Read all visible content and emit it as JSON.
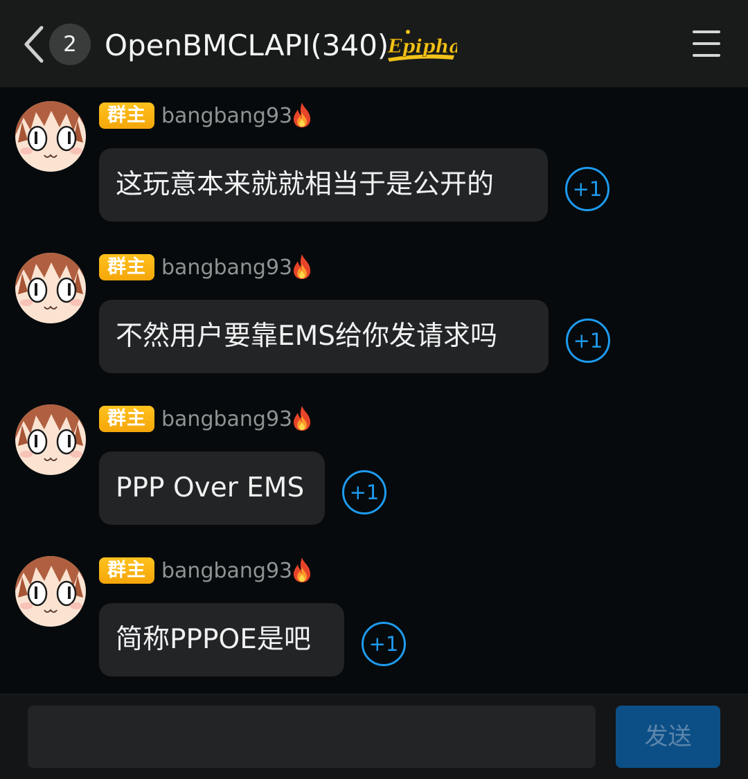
{
  "header": {
    "unread_count": "2",
    "title": "OpenBMCLAPI(340)",
    "back_icon": "chevron-left-icon",
    "menu_icon": "hamburger-menu-icon",
    "logo_text": "Epiphany"
  },
  "colors": {
    "accent": "#1e9bf0",
    "role_badge": "#f5a60a",
    "bubble": "#222426",
    "background": "#060a0c"
  },
  "messages": [
    {
      "role": "群主",
      "sender": "bangbang93",
      "text": "这玩意本来就就相当于是公开的",
      "reaction": "+1"
    },
    {
      "role": "群主",
      "sender": "bangbang93",
      "text": "不然用户要靠EMS给你发请求吗",
      "reaction": "+1"
    },
    {
      "role": "群主",
      "sender": "bangbang93",
      "text": "PPP Over EMS",
      "reaction": "+1"
    },
    {
      "role": "群主",
      "sender": "bangbang93",
      "text": "简称PPPOE是吧",
      "reaction": "+1"
    }
  ],
  "composer": {
    "placeholder": "",
    "send_label": "发送"
  }
}
